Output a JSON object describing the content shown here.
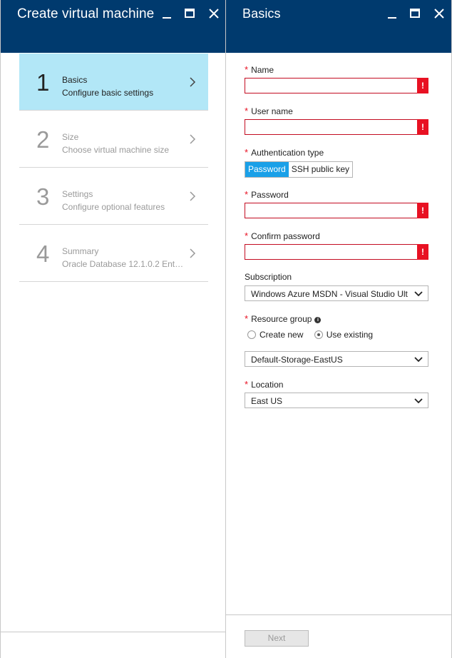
{
  "left_blade": {
    "title": "Create virtual machine",
    "steps": [
      {
        "number": "1",
        "title": "Basics",
        "subtitle": "Configure basic settings",
        "active": true
      },
      {
        "number": "2",
        "title": "Size",
        "subtitle": "Choose virtual machine size",
        "active": false
      },
      {
        "number": "3",
        "title": "Settings",
        "subtitle": "Configure optional features",
        "active": false
      },
      {
        "number": "4",
        "title": "Summary",
        "subtitle": "Oracle Database 12.1.0.2 Enter...",
        "active": false
      }
    ]
  },
  "right_blade": {
    "title": "Basics",
    "fields": {
      "name": {
        "label": "Name",
        "value": "",
        "required": true,
        "error_glyph": "!"
      },
      "user_name": {
        "label": "User name",
        "value": "",
        "required": true,
        "error_glyph": "!"
      },
      "auth_type": {
        "label": "Authentication type",
        "options": [
          "Password",
          "SSH public key"
        ],
        "selected": "Password",
        "required": true
      },
      "password": {
        "label": "Password",
        "value": "",
        "required": true,
        "error_glyph": "!"
      },
      "confirm_password": {
        "label": "Confirm password",
        "value": "",
        "required": true,
        "error_glyph": "!"
      },
      "subscription": {
        "label": "Subscription",
        "value": "Windows Azure MSDN - Visual Studio Ult"
      },
      "resource_group": {
        "label": "Resource group",
        "info_glyph": "i",
        "radio_options": [
          "Create new",
          "Use existing"
        ],
        "radio_selected": "Use existing",
        "value": "Default-Storage-EastUS",
        "required": true
      },
      "location": {
        "label": "Location",
        "value": "East US",
        "required": true
      }
    },
    "required_marker": "*",
    "next_label": "Next"
  },
  "colors": {
    "header_bg": "#003a6e",
    "active_step_bg": "#b2e7f7",
    "error_red": "#e81123",
    "toggle_selected": "#1aa0e8"
  },
  "icons": [
    "minimize-icon",
    "maximize-icon",
    "close-icon",
    "chevron-right-icon",
    "chevron-down-icon",
    "info-icon",
    "error-icon"
  ]
}
